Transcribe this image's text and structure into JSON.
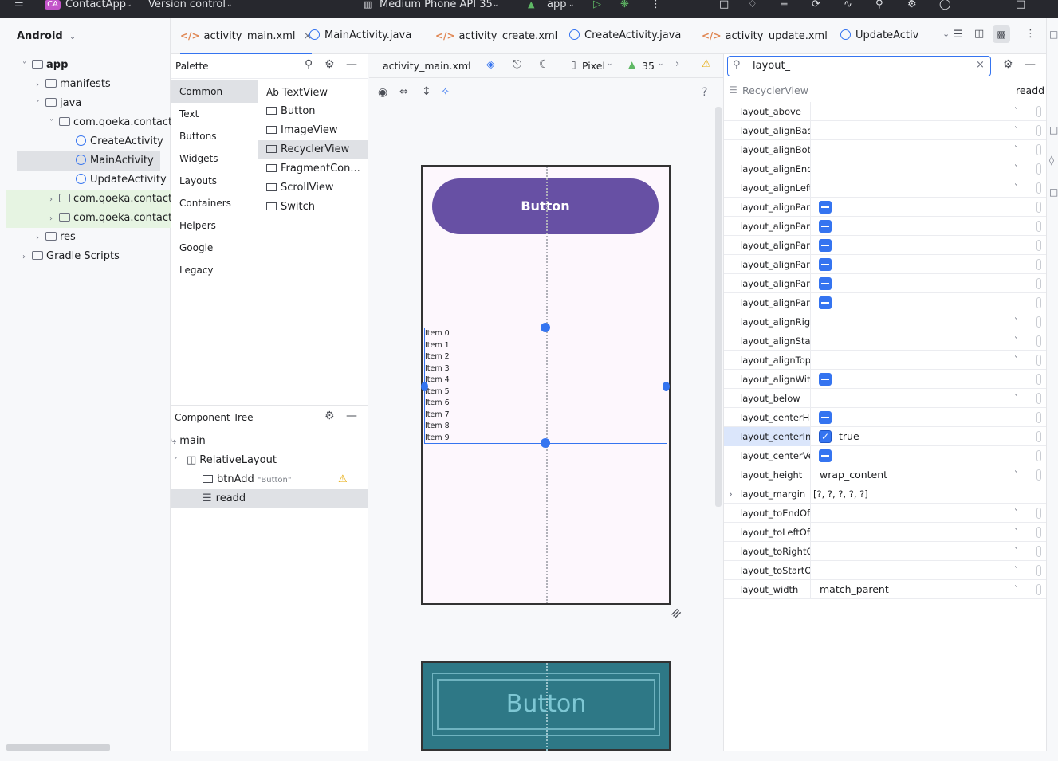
{
  "titlebar": {
    "project_badge": "CA",
    "project_name": "ContactApp",
    "vcs": "Version control",
    "device": "Medium Phone API 35",
    "run_config": "app"
  },
  "project_pane": {
    "view_label": "Android",
    "tree": [
      {
        "label": "app",
        "level": 0
      },
      {
        "label": "manifests",
        "level": 1
      },
      {
        "label": "java",
        "level": 1
      },
      {
        "label": "com.qoeka.contacta",
        "level": 2
      },
      {
        "label": "CreateActivity",
        "level": 3
      },
      {
        "label": "MainActivity",
        "level": 3
      },
      {
        "label": "UpdateActivity",
        "level": 3
      },
      {
        "label": "com.qoeka.contacta",
        "level": 2
      },
      {
        "label": "com.qoeka.contacta",
        "level": 2
      },
      {
        "label": "res",
        "level": 1
      },
      {
        "label": "Gradle Scripts",
        "level": 0
      }
    ]
  },
  "tabs": [
    {
      "label": "activity_main.xml",
      "kind": "xml",
      "active": true
    },
    {
      "label": "MainActivity.java",
      "kind": "java"
    },
    {
      "label": "activity_create.xml",
      "kind": "xml"
    },
    {
      "label": "CreateActivity.java",
      "kind": "java"
    },
    {
      "label": "activity_update.xml",
      "kind": "xml"
    },
    {
      "label": "UpdateActiv",
      "kind": "java"
    }
  ],
  "palette": {
    "title": "Palette",
    "categories": [
      "Common",
      "Text",
      "Buttons",
      "Widgets",
      "Layouts",
      "Containers",
      "Helpers",
      "Google",
      "Legacy"
    ],
    "items": [
      {
        "label": "TextView",
        "prefix": "Ab"
      },
      {
        "label": "Button"
      },
      {
        "label": "ImageView"
      },
      {
        "label": "RecyclerView"
      },
      {
        "label": "FragmentCon..."
      },
      {
        "label": "ScrollView"
      },
      {
        "label": "Switch"
      }
    ]
  },
  "component_tree": {
    "title": "Component Tree",
    "nodes": [
      {
        "label": "main",
        "level": 0
      },
      {
        "label": "RelativeLayout",
        "level": 1
      },
      {
        "label": "btnAdd",
        "hint": "\"Button\"",
        "level": 2,
        "warning": true
      },
      {
        "label": "readd",
        "level": 2,
        "selected": true
      }
    ]
  },
  "design": {
    "file": "activity_main.xml",
    "device": "Pixel",
    "api": "35",
    "help": "?",
    "button_text": "Button",
    "list_items": [
      "Item 0",
      "Item 1",
      "Item 2",
      "Item 3",
      "Item 4",
      "Item 5",
      "Item 6",
      "Item 7",
      "Item 8",
      "Item 9"
    ],
    "blueprint_button_text": "Button"
  },
  "attributes": {
    "search_value": "layout_",
    "selected_class": "RecyclerView",
    "selected_id": "readd",
    "rows": [
      {
        "name": "layout_above",
        "type": "dropdown",
        "value": ""
      },
      {
        "name": "layout_alignBas...",
        "type": "dropdown",
        "value": ""
      },
      {
        "name": "layout_alignBot...",
        "type": "dropdown",
        "value": ""
      },
      {
        "name": "layout_alignEnd",
        "type": "dropdown",
        "value": ""
      },
      {
        "name": "layout_alignLeft",
        "type": "dropdown",
        "value": ""
      },
      {
        "name": "layout_alignPar...",
        "type": "tri",
        "value": ""
      },
      {
        "name": "layout_alignPar...",
        "type": "tri",
        "value": ""
      },
      {
        "name": "layout_alignPar...",
        "type": "tri",
        "value": ""
      },
      {
        "name": "layout_alignPar...",
        "type": "tri",
        "value": ""
      },
      {
        "name": "layout_alignPar...",
        "type": "tri",
        "value": ""
      },
      {
        "name": "layout_alignPar...",
        "type": "tri",
        "value": ""
      },
      {
        "name": "layout_alignRig...",
        "type": "dropdown",
        "value": ""
      },
      {
        "name": "layout_alignStart",
        "type": "dropdown",
        "value": ""
      },
      {
        "name": "layout_alignTop",
        "type": "dropdown",
        "value": ""
      },
      {
        "name": "layout_alignWit...",
        "type": "tri",
        "value": ""
      },
      {
        "name": "layout_below",
        "type": "dropdown",
        "value": ""
      },
      {
        "name": "layout_centerH...",
        "type": "tri",
        "value": ""
      },
      {
        "name": "layout_centerIn...",
        "type": "check",
        "value": "true",
        "selected": true
      },
      {
        "name": "layout_centerVe...",
        "type": "tri",
        "value": ""
      },
      {
        "name": "layout_height",
        "type": "dropdown",
        "value": "wrap_content"
      },
      {
        "name": "layout_margin",
        "type": "expand",
        "value": "[?, ?, ?, ?, ?]"
      },
      {
        "name": "layout_toEndOf",
        "type": "dropdown",
        "value": ""
      },
      {
        "name": "layout_toLeftOf",
        "type": "dropdown",
        "value": ""
      },
      {
        "name": "layout_toRightOf",
        "type": "dropdown",
        "value": ""
      },
      {
        "name": "layout_toStartOf",
        "type": "dropdown",
        "value": ""
      },
      {
        "name": "layout_width",
        "type": "dropdown",
        "value": "match_parent"
      }
    ]
  },
  "colors": {
    "accent": "#3574f0",
    "button_purple": "#6750a4",
    "blueprint_bg": "#2e7886",
    "warning": "#e6a700"
  }
}
